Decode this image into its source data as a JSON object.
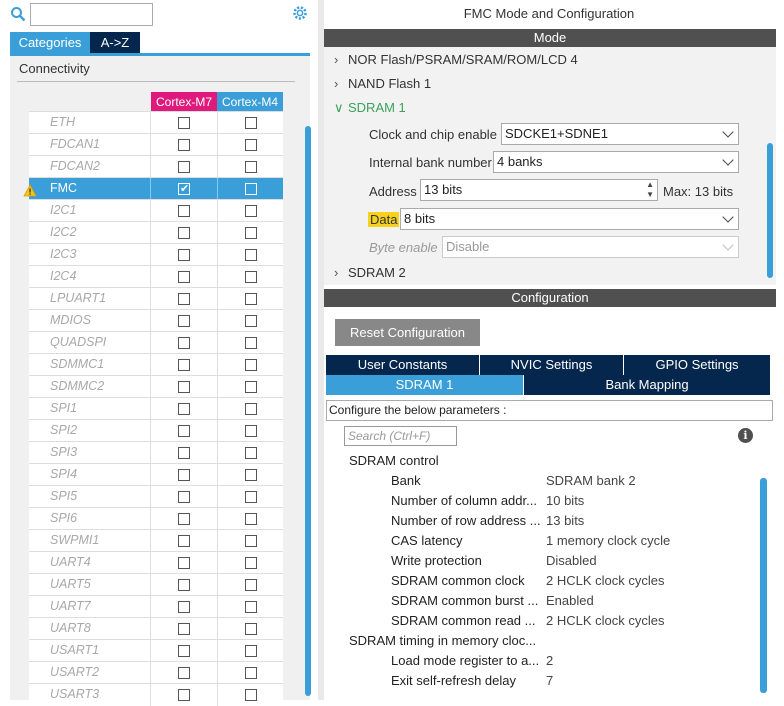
{
  "left": {
    "search_placeholder": "",
    "tabs": {
      "categories": "Categories",
      "az": "A->Z"
    },
    "section": "Connectivity",
    "col_m7": "Cortex-M7",
    "col_m4": "Cortex-M4",
    "rows": [
      {
        "name": "ETH",
        "m7": false,
        "m4": false,
        "selected": false
      },
      {
        "name": "FDCAN1",
        "m7": false,
        "m4": false,
        "selected": false
      },
      {
        "name": "FDCAN2",
        "m7": false,
        "m4": false,
        "selected": false
      },
      {
        "name": "FMC",
        "m7": true,
        "m4": false,
        "selected": true,
        "warning": true
      },
      {
        "name": "I2C1",
        "m7": false,
        "m4": false,
        "selected": false
      },
      {
        "name": "I2C2",
        "m7": false,
        "m4": false,
        "selected": false
      },
      {
        "name": "I2C3",
        "m7": false,
        "m4": false,
        "selected": false
      },
      {
        "name": "I2C4",
        "m7": false,
        "m4": false,
        "selected": false
      },
      {
        "name": "LPUART1",
        "m7": false,
        "m4": false,
        "selected": false
      },
      {
        "name": "MDIOS",
        "m7": false,
        "m4": false,
        "selected": false
      },
      {
        "name": "QUADSPI",
        "m7": false,
        "m4": false,
        "selected": false
      },
      {
        "name": "SDMMC1",
        "m7": false,
        "m4": false,
        "selected": false
      },
      {
        "name": "SDMMC2",
        "m7": false,
        "m4": false,
        "selected": false
      },
      {
        "name": "SPI1",
        "m7": false,
        "m4": false,
        "selected": false
      },
      {
        "name": "SPI2",
        "m7": false,
        "m4": false,
        "selected": false
      },
      {
        "name": "SPI3",
        "m7": false,
        "m4": false,
        "selected": false
      },
      {
        "name": "SPI4",
        "m7": false,
        "m4": false,
        "selected": false
      },
      {
        "name": "SPI5",
        "m7": false,
        "m4": false,
        "selected": false
      },
      {
        "name": "SPI6",
        "m7": false,
        "m4": false,
        "selected": false
      },
      {
        "name": "SWPMI1",
        "m7": false,
        "m4": false,
        "selected": false
      },
      {
        "name": "UART4",
        "m7": false,
        "m4": false,
        "selected": false
      },
      {
        "name": "UART5",
        "m7": false,
        "m4": false,
        "selected": false
      },
      {
        "name": "UART7",
        "m7": false,
        "m4": false,
        "selected": false
      },
      {
        "name": "UART8",
        "m7": false,
        "m4": false,
        "selected": false
      },
      {
        "name": "USART1",
        "m7": false,
        "m4": false,
        "selected": false
      },
      {
        "name": "USART2",
        "m7": false,
        "m4": false,
        "selected": false
      },
      {
        "name": "USART3",
        "m7": false,
        "m4": false,
        "selected": false
      }
    ]
  },
  "right": {
    "title": "FMC Mode and Configuration",
    "mode_bar": "Mode",
    "tree": {
      "nor": "NOR Flash/PSRAM/SRAM/ROM/LCD 4",
      "nand": "NAND Flash 1",
      "sdram1": "SDRAM 1",
      "sdram2": "SDRAM 2"
    },
    "fields": {
      "clock_label": "Clock and chip enable",
      "clock_value": "SDCKE1+SDNE1",
      "bank_label": "Internal bank number",
      "bank_value": "4 banks",
      "addr_label": "Address",
      "addr_value": "13 bits",
      "addr_max": "Max: 13 bits",
      "data_label": "Data",
      "data_value": "8 bits",
      "byte_label": "Byte enable",
      "byte_value": "Disable"
    },
    "config_bar": "Configuration",
    "reset_label": "Reset Configuration",
    "tabs": {
      "user": "User Constants",
      "nvic": "NVIC Settings",
      "gpio": "GPIO Settings",
      "sdram1": "SDRAM 1",
      "bankmap": "Bank Mapping"
    },
    "params_text": "Configure the below parameters :",
    "params_search": "Search (Ctrl+F)",
    "groups": {
      "control": "SDRAM control",
      "timing": "SDRAM timing in memory cloc..."
    },
    "params": [
      {
        "name": "Bank",
        "value": "SDRAM bank 2"
      },
      {
        "name": "Number of column addr...",
        "value": "10 bits"
      },
      {
        "name": "Number of row address ...",
        "value": "13 bits"
      },
      {
        "name": "CAS latency",
        "value": "1 memory clock cycle"
      },
      {
        "name": "Write protection",
        "value": "Disabled"
      },
      {
        "name": "SDRAM common clock",
        "value": "2 HCLK clock cycles"
      },
      {
        "name": "SDRAM common burst ...",
        "value": "Enabled"
      },
      {
        "name": "SDRAM common read ...",
        "value": "2 HCLK clock cycles"
      }
    ],
    "timing": [
      {
        "name": "Load mode register to a...",
        "value": "2"
      },
      {
        "name": "Exit self-refresh delay",
        "value": "7"
      }
    ]
  }
}
